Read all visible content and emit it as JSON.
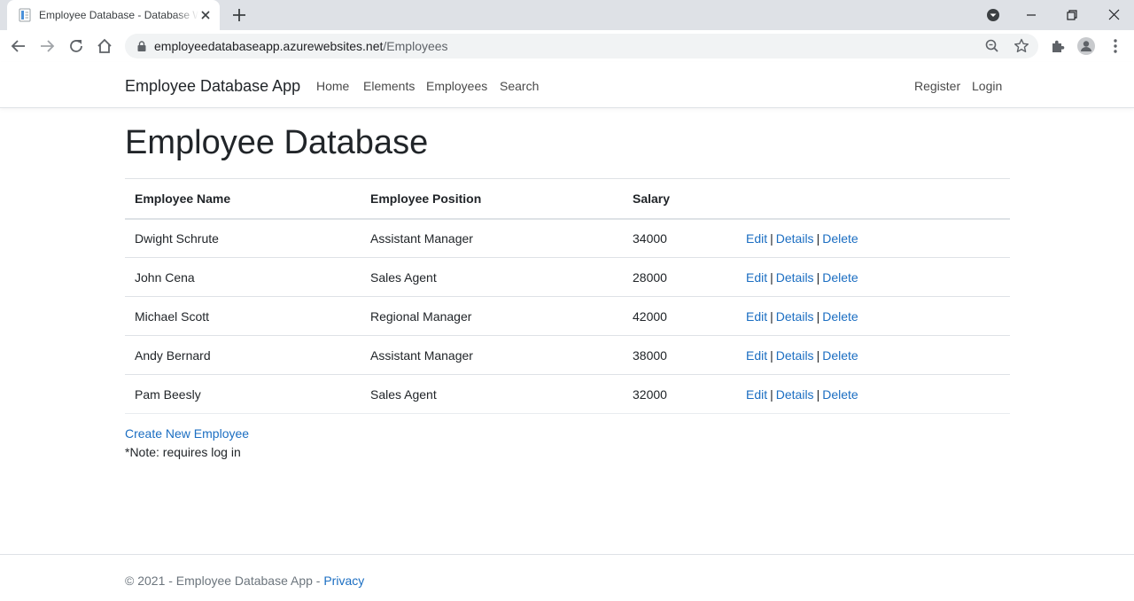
{
  "browser": {
    "tab_title": "Employee Database - Database Web App",
    "url_host": "employeedatabaseapp.azurewebsites.net",
    "url_path": "/Employees",
    "icons": [
      "favicon-icon",
      "close-icon",
      "plus-icon",
      "profile-dropdown-icon",
      "minimize-icon",
      "restore-icon",
      "close-window-icon",
      "back-icon",
      "forward-icon",
      "reload-icon",
      "home-icon",
      "lock-icon",
      "zoom-icon",
      "star-icon",
      "extensions-icon",
      "profile-icon",
      "more-icon"
    ]
  },
  "nav": {
    "brand": "Employee Database App",
    "links": [
      "Home",
      "Elements",
      "Employees",
      "Search"
    ],
    "register": "Register",
    "login": "Login"
  },
  "page": {
    "title": "Employee Database",
    "columns": [
      "Employee Name",
      "Employee Position",
      "Salary"
    ],
    "rows": [
      {
        "name": "Dwight Schrute",
        "position": "Assistant Manager",
        "salary": "34000"
      },
      {
        "name": "John Cena",
        "position": "Sales Agent",
        "salary": "28000"
      },
      {
        "name": "Michael Scott",
        "position": "Regional Manager",
        "salary": "42000"
      },
      {
        "name": "Andy Bernard",
        "position": "Assistant Manager",
        "salary": "38000"
      },
      {
        "name": "Pam Beesly",
        "position": "Sales Agent",
        "salary": "32000"
      }
    ],
    "actions": {
      "edit": "Edit",
      "details": "Details",
      "delete": "Delete",
      "separator": "|"
    },
    "create_link": "Create New Employee",
    "note": "*Note: requires log in"
  },
  "footer": {
    "text": "© 2021 - Employee Database App - ",
    "privacy": "Privacy"
  },
  "colors": {
    "link": "#1b6ec2",
    "text": "#212529",
    "muted": "#6c757d",
    "border": "#dee2e6",
    "tabstrip": "#dee1e6",
    "omnibox": "#f1f3f4"
  }
}
